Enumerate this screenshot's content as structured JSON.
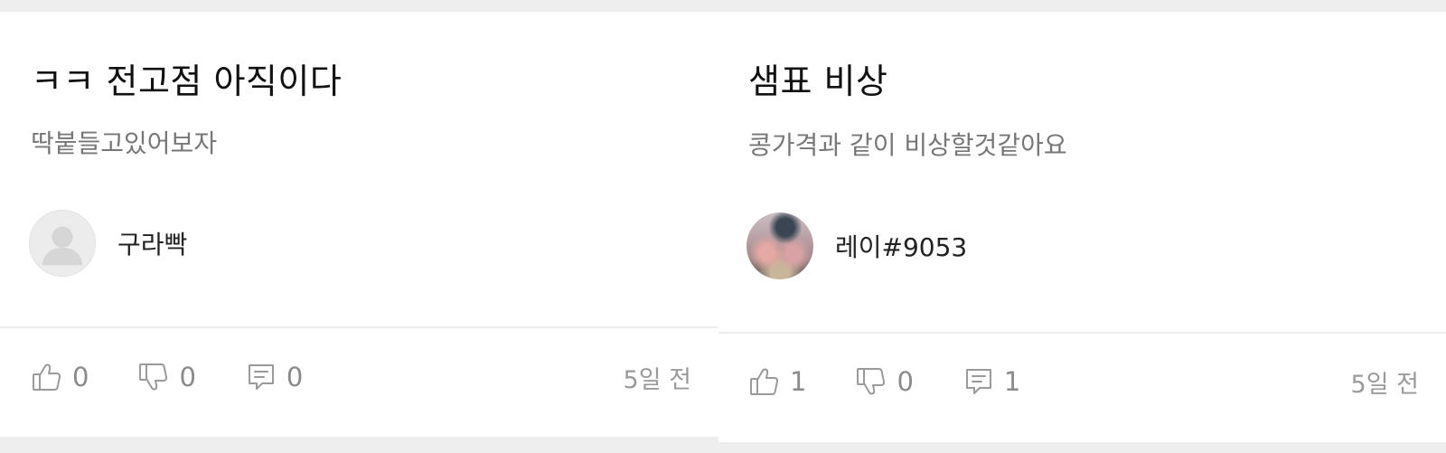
{
  "posts": [
    {
      "title": "ㅋㅋ 전고점 아직이다",
      "body": "딱붙들고있어보자",
      "author": "구라빡",
      "likes": "0",
      "dislikes": "0",
      "comments": "0",
      "time": "5일 전"
    },
    {
      "title": "샘표 비상",
      "body": "콩가격과 같이 비상할것같아요",
      "author": "레이#9053",
      "likes": "1",
      "dislikes": "0",
      "comments": "1",
      "time": "5일 전"
    }
  ],
  "icons": {
    "like": "thumbs-up-icon",
    "dislike": "thumbs-down-icon",
    "comment": "comment-icon",
    "default_avatar": "default-user-icon"
  },
  "colors": {
    "background": "#eeeeee",
    "card": "#ffffff",
    "title": "#111111",
    "body": "#777777",
    "meta": "#8a8a8a"
  }
}
